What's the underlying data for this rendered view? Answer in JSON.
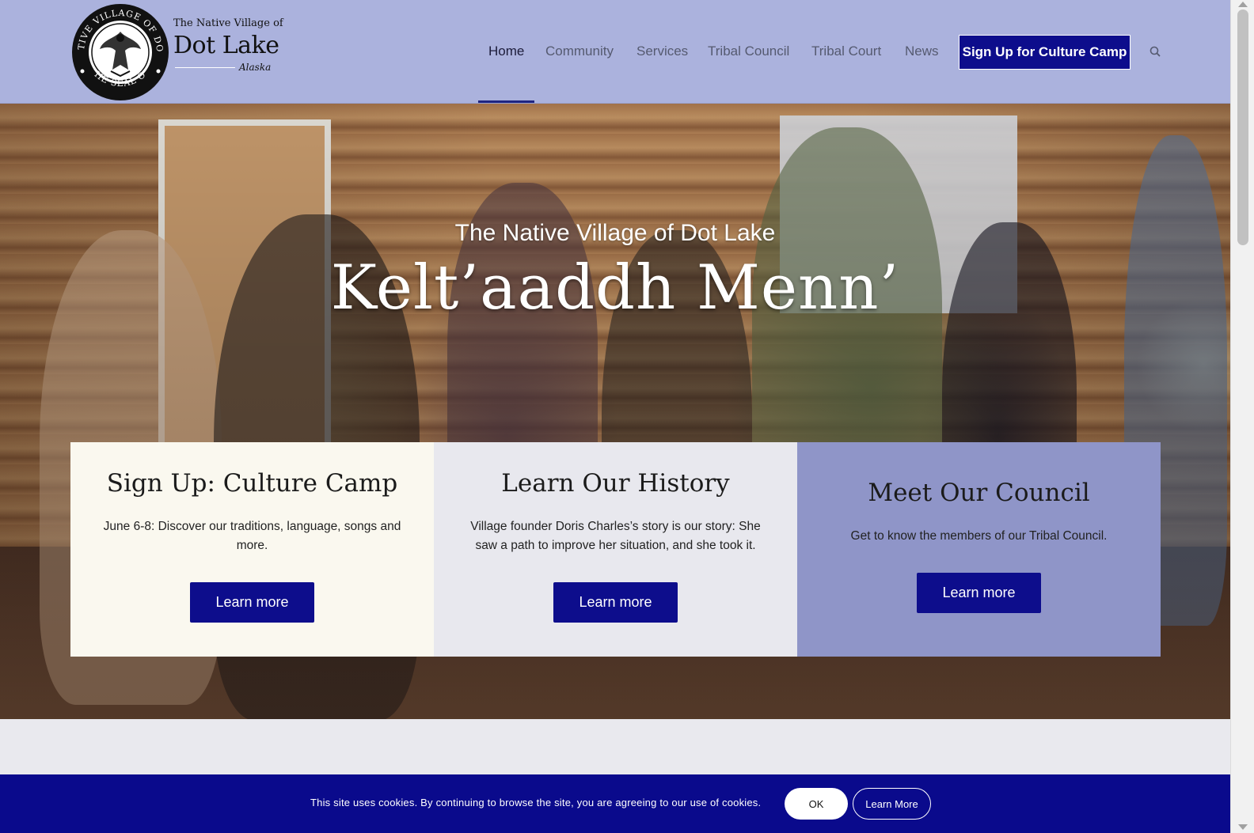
{
  "header": {
    "logo": {
      "small_text": "The Native Village of",
      "big_text": "Dot Lake",
      "state_text": "Alaska",
      "seal_text_top": "THE NATIVE VILLAGE OF DOT LAKE",
      "seal_text_bottom": "THE SEAL OF"
    },
    "nav": [
      {
        "label": "Home",
        "active": true
      },
      {
        "label": "Community",
        "active": false
      },
      {
        "label": "Services",
        "active": false
      },
      {
        "label": "Tribal Council",
        "active": false
      },
      {
        "label": "Tribal Court",
        "active": false
      },
      {
        "label": "News",
        "active": false
      }
    ],
    "cta_label": "Sign Up for Culture Camp",
    "search_icon": "search-icon"
  },
  "hero": {
    "subtitle": "The Native Village of Dot Lake",
    "title": "Kelt’aaddh Menn’"
  },
  "cards": [
    {
      "title": "Sign Up: Culture Camp",
      "text": "June 6-8: Discover our traditions, language, songs and more.",
      "button": "Learn more"
    },
    {
      "title": "Learn Our History",
      "text": "Village founder Doris Charles’s story is our story: She saw a path to improve her situation, and she took it.",
      "button": "Learn more"
    },
    {
      "title": "Meet Our Council",
      "text": "Get to know the members of our Tribal Council.",
      "button": "Learn more"
    }
  ],
  "cookie": {
    "text": "This site uses cookies. By continuing to browse the site, you are agreeing to our use of cookies.",
    "ok_label": "OK",
    "more_label": "Learn More"
  },
  "colors": {
    "header_bg": "#abb2dd",
    "accent": "#0d0d8c",
    "card1_bg": "#faf8ef",
    "card2_bg": "#e8e8ee",
    "card3_bg": "#8f95c8"
  }
}
